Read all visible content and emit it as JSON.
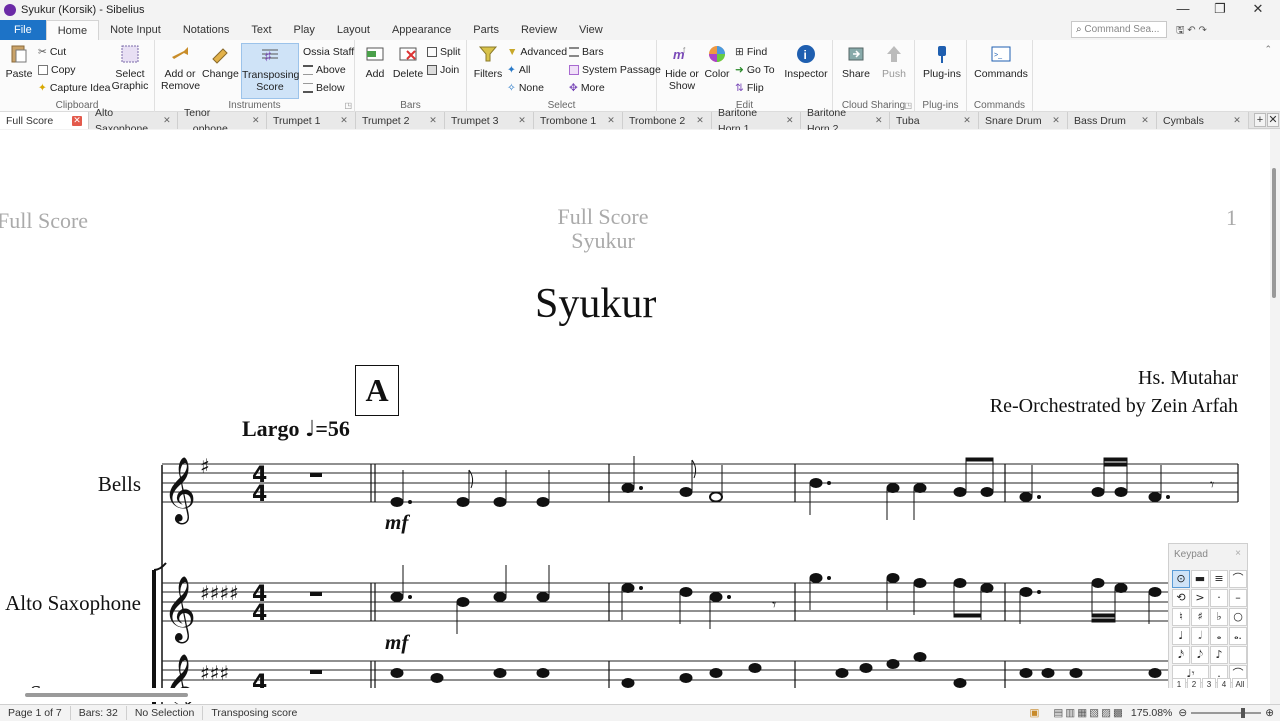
{
  "window": {
    "title": "Syukur (Korsik) - Sibelius",
    "min": "—",
    "max": "❐",
    "close": "✕"
  },
  "menu": {
    "tabs": [
      "File",
      "Home",
      "Note Input",
      "Notations",
      "Text",
      "Play",
      "Layout",
      "Appearance",
      "Parts",
      "Review",
      "View"
    ],
    "active": "Home"
  },
  "search": {
    "placeholder": "Command Sea..."
  },
  "ribbon": {
    "clipboard": {
      "label": "Clipboard",
      "paste": "Paste",
      "cut": "Cut",
      "copy": "Copy",
      "capture": "Capture Idea",
      "select_graphic": "Select Graphic"
    },
    "instruments": {
      "label": "Instruments",
      "add_remove": "Add or Remove",
      "change": "Change",
      "transposing": "Transposing Score",
      "ossia": "Ossia Staff",
      "above": "Above",
      "below": "Below"
    },
    "bars": {
      "label": "Bars",
      "add": "Add",
      "delete": "Delete",
      "split": "Split",
      "join": "Join"
    },
    "select": {
      "label": "Select",
      "filters": "Filters",
      "advanced": "Advanced",
      "all": "All",
      "none": "None",
      "bars": "Bars",
      "system_passage": "System Passage",
      "more": "More"
    },
    "edit": {
      "label": "Edit",
      "hide_show": "Hide or Show",
      "color": "Color",
      "find": "Find",
      "goto": "Go To",
      "flip": "Flip",
      "inspector": "Inspector"
    },
    "cloud": {
      "label": "Cloud Sharing",
      "share": "Share",
      "push": "Push"
    },
    "plugins": {
      "label": "Plug-ins",
      "plugins": "Plug-ins"
    },
    "commands": {
      "label": "Commands",
      "commands": "Commands"
    }
  },
  "part_tabs": [
    "Full Score",
    "Alto Saxophone",
    "Tenor ...ophone",
    "Trumpet 1",
    "Trumpet 2",
    "Trumpet 3",
    "Trombone 1",
    "Trombone 2",
    "Baritone Horn 1",
    "Baritone Horn 2",
    "Tuba",
    "Snare Drum",
    "Bass Drum",
    "Cymbals"
  ],
  "score": {
    "header_left": "Full Score",
    "header_center_1": "Full Score",
    "header_center_2": "Syukur",
    "page_number": "1",
    "title": "Syukur",
    "composer": "Hs. Mutahar",
    "arranger": "Re-Orchestrated by Zein Arfah",
    "rehearsal_mark": "A",
    "tempo_text": "Largo",
    "tempo_value": "=56",
    "instruments": [
      "Bells",
      "Alto Saxophone"
    ],
    "dynamic": "mf",
    "time_signature": "4/4"
  },
  "keypad": {
    "title": "Keypad",
    "close": "×",
    "keys": [
      "⊙",
      "▬",
      "≡",
      "⌒",
      "⤫",
      "♪",
      "⟲",
      ">",
      "·",
      "–",
      "♮",
      "♯",
      "♭",
      "○",
      "♩",
      "𝅗𝅥",
      "𝅝",
      "𝅝.",
      "𝅘𝅥𝅯",
      "𝅘𝅥𝅮",
      "♪",
      "",
      "♩𝄾",
      "",
      ".",
      "⌒"
    ],
    "tabs": [
      "1",
      "2",
      "3",
      "4",
      "All"
    ]
  },
  "status": {
    "page": "Page 1 of 7",
    "bars": "Bars: 32",
    "selection": "No Selection",
    "mode": "Transposing score",
    "zoom": "175.08%"
  }
}
